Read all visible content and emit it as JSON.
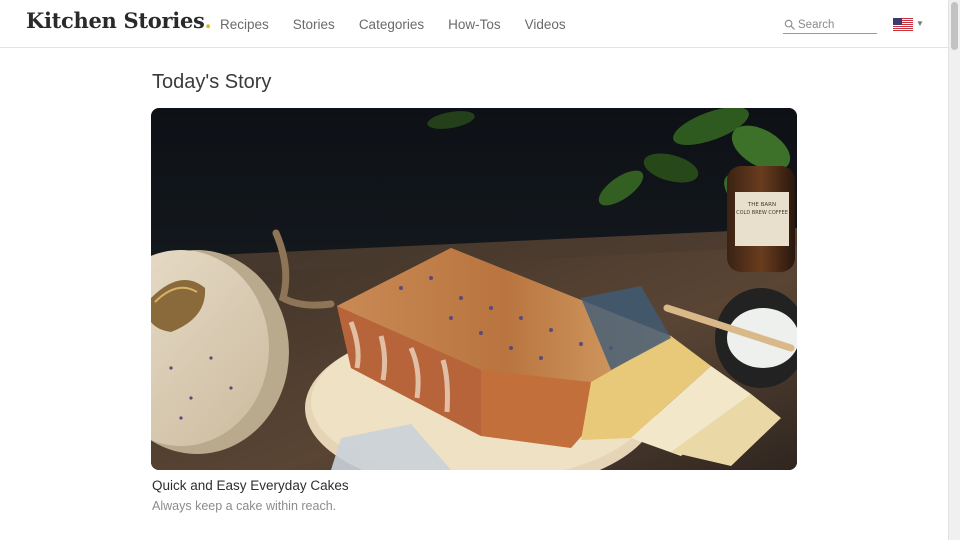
{
  "header": {
    "logo_text": "Kitchen Stories",
    "logo_dot": ".",
    "nav": [
      {
        "label": "Recipes"
      },
      {
        "label": "Stories"
      },
      {
        "label": "Categories"
      },
      {
        "label": "How-Tos"
      },
      {
        "label": "Videos"
      }
    ],
    "search": {
      "placeholder": "Search",
      "icon": "search-icon"
    },
    "locale": {
      "icon": "us-flag-icon",
      "caret_icon": "caret-down-icon"
    }
  },
  "main": {
    "section_title": "Today's Story",
    "story": {
      "title": "Quick and Easy Everyday Cakes",
      "subtitle": "Always keep a cake within reach.",
      "bottle_label": "THE BARN COLD BREW COFFEE"
    }
  },
  "colors": {
    "logo_dot": "#e0b82a",
    "nav_text": "#6a6a6a",
    "subtitle_text": "#8c8c8c",
    "header_border": "#e3e3e3"
  }
}
